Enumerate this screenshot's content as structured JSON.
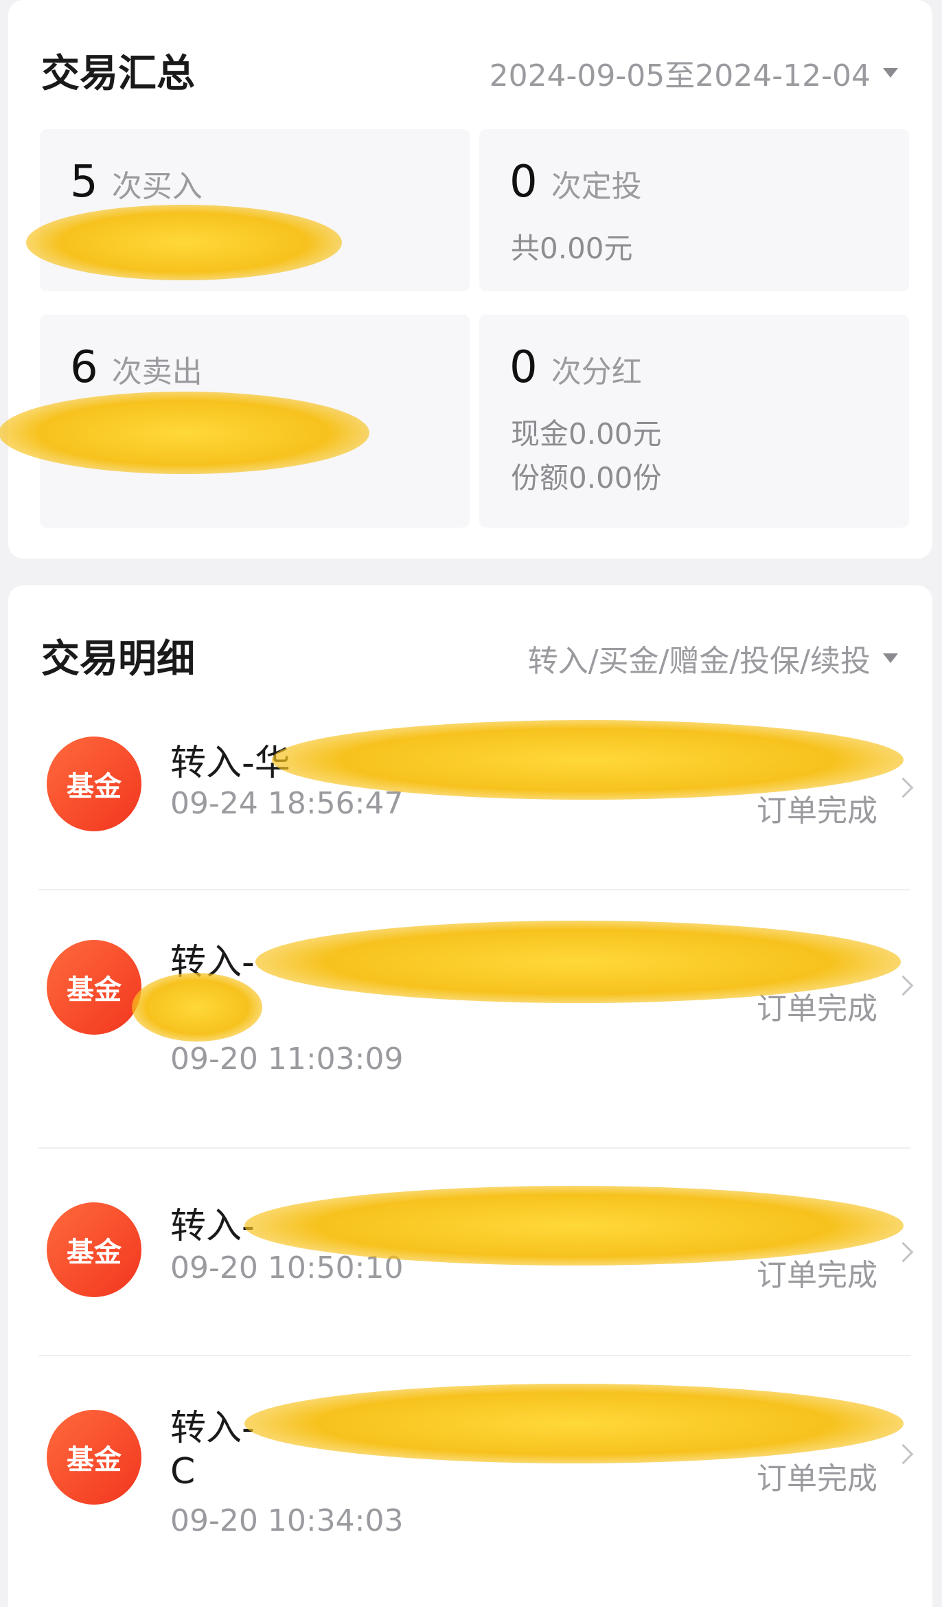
{
  "summary": {
    "title": "交易汇总",
    "date_range": "2024-09-05至2024-12-04",
    "tiles": {
      "buy": {
        "count": "5",
        "label": "次买入"
      },
      "sip": {
        "count": "0",
        "label": "次定投",
        "sub1": "共0.00元"
      },
      "sell": {
        "count": "6",
        "label": "次卖出"
      },
      "dividend": {
        "count": "0",
        "label": "次分红",
        "sub1": "现金0.00元",
        "sub2": "份额0.00份"
      }
    }
  },
  "details": {
    "title": "交易明细",
    "filter": "转入/买金/赠金/投保/续投",
    "rows": [
      {
        "badge": "基金",
        "title": "转入-华",
        "time": "09-24 18:56:47",
        "status": "订单完成"
      },
      {
        "badge": "基金",
        "title": "转入-",
        "time": "09-20 11:03:09",
        "status": "订单完成"
      },
      {
        "badge": "基金",
        "title": "转入-",
        "time": "09-20 10:50:10",
        "status": "订单完成"
      },
      {
        "badge": "基金",
        "title": "转入-",
        "title_line2": "C",
        "time": "09-20 10:34:03",
        "status": "订单完成"
      }
    ]
  }
}
